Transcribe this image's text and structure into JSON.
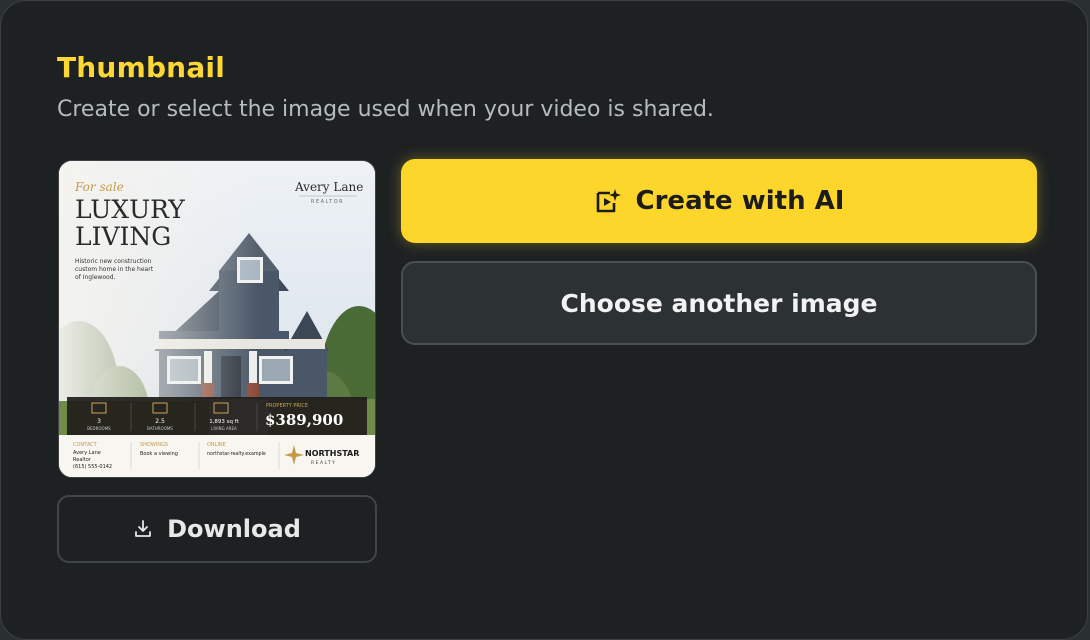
{
  "section": {
    "title": "Thumbnail",
    "subtitle": "Create or select the image used when your video is shared."
  },
  "thumbnail": {
    "tagline": "For sale",
    "headline_line1": "LUXURY",
    "headline_line2": "LIVING",
    "description_line1": "Historic new construction",
    "description_line2": "custom home in the heart",
    "description_line3": "of Inglewood.",
    "agent_name": "Avery Lane",
    "agent_title": "REALTOR",
    "stats": [
      {
        "value": "3",
        "label": "BEDROOMS"
      },
      {
        "value": "2.5",
        "label": "BATHROOMS"
      },
      {
        "value": "1,893 sq ft",
        "label": "LIVING AREA"
      }
    ],
    "price_label": "PROPERTY PRICE",
    "price": "$389,900",
    "contact_label": "CONTACT",
    "contact_line1": "Avery Lane",
    "contact_line2": "Realtor",
    "contact_line3": "(615) 555-0142",
    "showings_label": "SHOWINGS",
    "showings_value": "Book a viewing",
    "online_label": "ONLINE",
    "online_value": "northstar-realty.example",
    "brand_name": "NORTHSTAR",
    "brand_sub": "REALTY"
  },
  "actions": {
    "create_ai_label": "Create with AI",
    "choose_label": "Choose another image",
    "download_label": "Download"
  },
  "icons": {
    "create_ai": "video-sparkle-icon",
    "download": "download-icon"
  },
  "colors": {
    "accent": "#fdd62b",
    "title": "#fdd835",
    "background": "#1d2122"
  }
}
